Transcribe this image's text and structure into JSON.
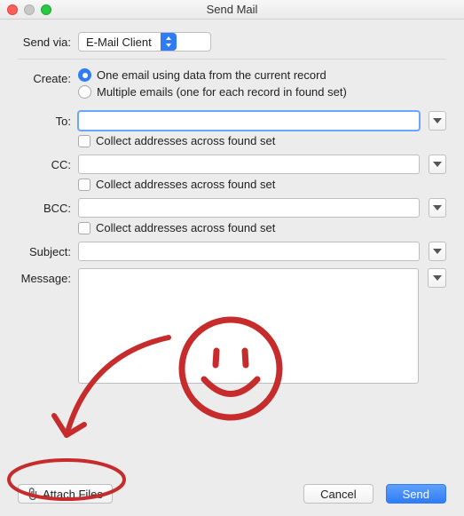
{
  "window": {
    "title": "Send Mail"
  },
  "sendVia": {
    "label": "Send via:",
    "value": "E-Mail Client"
  },
  "create": {
    "label": "Create:",
    "options": [
      {
        "label": "One email using data from the current record",
        "checked": true
      },
      {
        "label": "Multiple emails (one for each record in found set)",
        "checked": false
      }
    ]
  },
  "to": {
    "label": "To:",
    "value": "",
    "collect": "Collect addresses across found set"
  },
  "cc": {
    "label": "CC:",
    "value": "",
    "collect": "Collect addresses across found set"
  },
  "bcc": {
    "label": "BCC:",
    "value": "",
    "collect": "Collect addresses across found set"
  },
  "subject": {
    "label": "Subject:",
    "value": ""
  },
  "message": {
    "label": "Message:",
    "value": ""
  },
  "footer": {
    "attach": "Attach Files",
    "cancel": "Cancel",
    "send": "Send"
  },
  "annotation": {
    "color": "#c72c2c"
  }
}
